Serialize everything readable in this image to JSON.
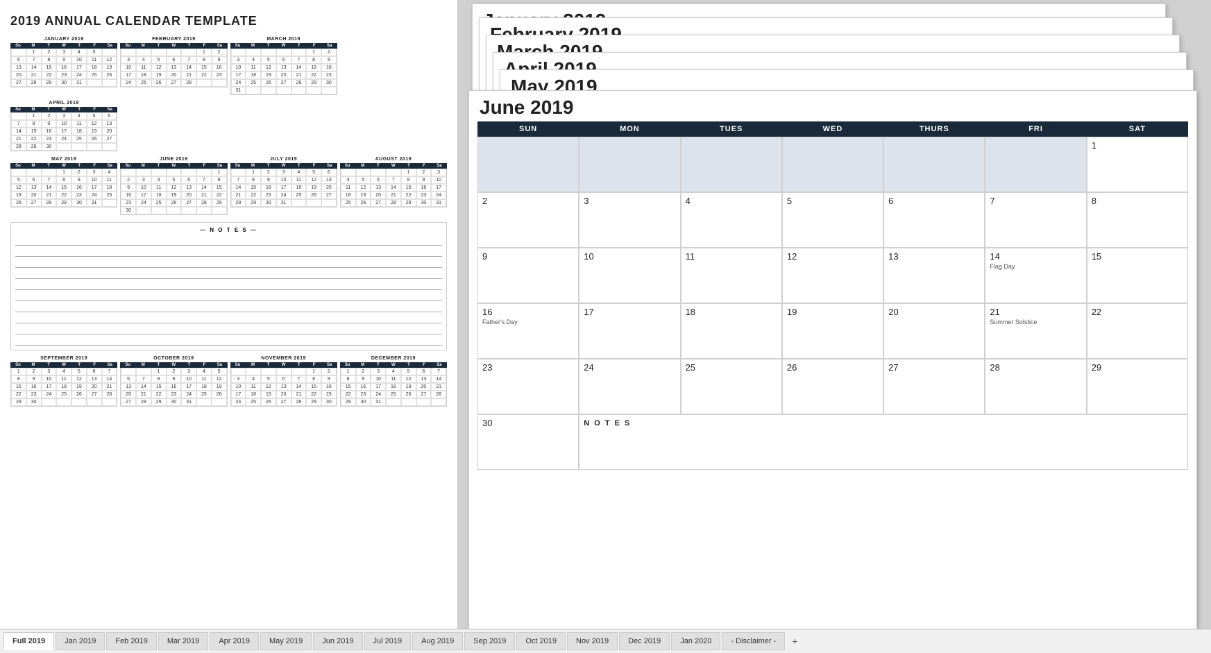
{
  "title": "2019 ANNUAL CALENDAR TEMPLATE",
  "months": {
    "jan": {
      "name": "JANUARY 2019",
      "header": [
        "Su",
        "M",
        "T",
        "W",
        "T",
        "F",
        "Sa"
      ],
      "weeks": [
        [
          "",
          "1",
          "2",
          "3",
          "4",
          "5",
          ""
        ],
        [
          "6",
          "7",
          "8",
          "9",
          "10",
          "11",
          "12"
        ],
        [
          "13",
          "14",
          "15",
          "16",
          "17",
          "18",
          "19"
        ],
        [
          "20",
          "21",
          "22",
          "23",
          "24",
          "25",
          "26"
        ],
        [
          "27",
          "28",
          "29",
          "30",
          "31",
          "",
          ""
        ]
      ]
    },
    "feb": {
      "name": "FEBRUARY 2019",
      "header": [
        "Su",
        "M",
        "T",
        "W",
        "T",
        "F",
        "Sa"
      ],
      "weeks": [
        [
          "",
          "",
          "",
          "",
          "",
          "1",
          "2"
        ],
        [
          "3",
          "4",
          "5",
          "6",
          "7",
          "8",
          "9"
        ],
        [
          "10",
          "11",
          "12",
          "13",
          "14",
          "15",
          "16"
        ],
        [
          "17",
          "18",
          "19",
          "20",
          "21",
          "22",
          "23"
        ],
        [
          "24",
          "25",
          "26",
          "27",
          "28",
          "",
          ""
        ]
      ]
    },
    "mar": {
      "name": "MARCH 2019",
      "header": [
        "Su",
        "M",
        "T",
        "W",
        "T",
        "F",
        "Sa"
      ],
      "weeks": [
        [
          "",
          "",
          "",
          "",
          "",
          "1",
          "2"
        ],
        [
          "3",
          "4",
          "5",
          "6",
          "7",
          "8",
          "9"
        ],
        [
          "10",
          "11",
          "12",
          "13",
          "14",
          "15",
          "16"
        ],
        [
          "17",
          "18",
          "19",
          "20",
          "21",
          "22",
          "23"
        ],
        [
          "24",
          "25",
          "26",
          "27",
          "28",
          "29",
          "30"
        ],
        [
          "31",
          "",
          "",
          "",
          "",
          "",
          ""
        ]
      ]
    },
    "apr": {
      "name": "APRIL 2019",
      "header": [
        "Su",
        "M",
        "T",
        "W",
        "T",
        "F",
        "Sa"
      ],
      "weeks": [
        [
          "",
          "1",
          "2",
          "3",
          "4",
          "5",
          "6"
        ],
        [
          "7",
          "8",
          "9",
          "10",
          "11",
          "12",
          "13"
        ],
        [
          "14",
          "15",
          "16",
          "17",
          "18",
          "19",
          "20"
        ],
        [
          "21",
          "22",
          "23",
          "24",
          "25",
          "26",
          "27"
        ],
        [
          "28",
          "29",
          "30",
          "",
          "",
          "",
          ""
        ]
      ]
    },
    "may": {
      "name": "MAY 2019",
      "header": [
        "Su",
        "M",
        "T",
        "W",
        "T",
        "F",
        "Sa"
      ],
      "weeks": [
        [
          "",
          "",
          "",
          "1",
          "2",
          "3",
          "4"
        ],
        [
          "5",
          "6",
          "7",
          "8",
          "9",
          "10",
          "11"
        ],
        [
          "12",
          "13",
          "14",
          "15",
          "16",
          "17",
          "18"
        ],
        [
          "19",
          "20",
          "21",
          "22",
          "23",
          "24",
          "25"
        ],
        [
          "26",
          "27",
          "28",
          "29",
          "30",
          "31",
          ""
        ]
      ]
    },
    "jun": {
      "name": "JUNE 2019",
      "title_display": "June 2019",
      "header": [
        "SUN",
        "MON",
        "TUES",
        "WED",
        "THURS",
        "FRI",
        "SAT"
      ],
      "weeks": [
        [
          "",
          "",
          "",
          "",
          "",
          "",
          "1"
        ],
        [
          "2",
          "3",
          "4",
          "5",
          "6",
          "7",
          "8"
        ],
        [
          "9",
          "10",
          "11",
          "12",
          "13",
          "14",
          "15"
        ],
        [
          "16",
          "17",
          "18",
          "19",
          "20",
          "21",
          "22"
        ],
        [
          "23",
          "24",
          "25",
          "26",
          "27",
          "28",
          "29"
        ],
        [
          "30",
          "",
          "",
          "",
          "",
          "",
          ""
        ]
      ],
      "holidays": {
        "14": "Flag Day",
        "16": "Father's Day",
        "21": "Summer Solstice"
      }
    },
    "jul": {
      "name": "JULY 2019",
      "header": [
        "Su",
        "M",
        "T",
        "W",
        "T",
        "F",
        "Sa"
      ],
      "weeks": [
        [
          "",
          "1",
          "2",
          "3",
          "4",
          "5",
          "6"
        ],
        [
          "7",
          "8",
          "9",
          "10",
          "11",
          "12",
          "13"
        ],
        [
          "14",
          "15",
          "16",
          "17",
          "18",
          "19",
          "20"
        ],
        [
          "21",
          "22",
          "23",
          "24",
          "25",
          "26",
          "27"
        ],
        [
          "28",
          "29",
          "30",
          "31",
          "",
          "",
          ""
        ]
      ]
    },
    "aug": {
      "name": "AUGUST 2019",
      "header": [
        "Su",
        "M",
        "T",
        "W",
        "T",
        "F",
        "Sa"
      ],
      "weeks": [
        [
          "",
          "",
          "",
          "",
          "1",
          "2",
          "3"
        ],
        [
          "4",
          "5",
          "6",
          "7",
          "8",
          "9",
          "10"
        ],
        [
          "11",
          "12",
          "13",
          "14",
          "15",
          "16",
          "17"
        ],
        [
          "18",
          "19",
          "20",
          "21",
          "22",
          "23",
          "24"
        ],
        [
          "25",
          "26",
          "27",
          "28",
          "29",
          "30",
          "31"
        ]
      ]
    },
    "sep": {
      "name": "SEPTEMBER 2019",
      "header": [
        "Su",
        "M",
        "T",
        "W",
        "T",
        "F",
        "Sa"
      ],
      "weeks": [
        [
          "1",
          "2",
          "3",
          "4",
          "5",
          "6",
          "7"
        ],
        [
          "8",
          "9",
          "10",
          "11",
          "12",
          "13",
          "14"
        ],
        [
          "15",
          "16",
          "17",
          "18",
          "19",
          "20",
          "21"
        ],
        [
          "22",
          "23",
          "24",
          "25",
          "26",
          "27",
          "28"
        ],
        [
          "29",
          "30",
          "",
          "",
          "",
          "",
          ""
        ]
      ]
    },
    "oct": {
      "name": "OCTOBER 2019",
      "header": [
        "Su",
        "M",
        "T",
        "W",
        "T",
        "F",
        "Sa"
      ],
      "weeks": [
        [
          "",
          "",
          "1",
          "2",
          "3",
          "4",
          "5"
        ],
        [
          "6",
          "7",
          "8",
          "9",
          "10",
          "11",
          "12"
        ],
        [
          "13",
          "14",
          "15",
          "16",
          "17",
          "18",
          "19"
        ],
        [
          "20",
          "21",
          "22",
          "23",
          "24",
          "25",
          "26"
        ],
        [
          "27",
          "28",
          "29",
          "30",
          "31",
          "",
          ""
        ]
      ]
    },
    "nov": {
      "name": "NOVEMBER 2019",
      "header": [
        "Su",
        "M",
        "T",
        "W",
        "T",
        "F",
        "Sa"
      ],
      "weeks": [
        [
          "",
          "",
          "",
          "",
          "",
          "1",
          "2"
        ],
        [
          "3",
          "4",
          "5",
          "6",
          "7",
          "8",
          "9"
        ],
        [
          "10",
          "11",
          "12",
          "13",
          "14",
          "15",
          "16"
        ],
        [
          "17",
          "18",
          "19",
          "20",
          "21",
          "22",
          "23"
        ],
        [
          "24",
          "25",
          "26",
          "27",
          "28",
          "29",
          "30"
        ]
      ]
    },
    "dec": {
      "name": "DECEMBER 2019",
      "header": [
        "Su",
        "M",
        "T",
        "W",
        "T",
        "F",
        "Sa"
      ],
      "weeks": [
        [
          "1",
          "2",
          "3",
          "4",
          "5",
          "6",
          "7"
        ],
        [
          "8",
          "9",
          "10",
          "11",
          "12",
          "13",
          "14"
        ],
        [
          "15",
          "16",
          "17",
          "18",
          "19",
          "20",
          "21"
        ],
        [
          "22",
          "23",
          "24",
          "25",
          "26",
          "27",
          "28"
        ],
        [
          "29",
          "30",
          "31",
          "",
          "",
          "",
          ""
        ]
      ]
    }
  },
  "tabs": [
    {
      "label": "Full 2019",
      "active": true
    },
    {
      "label": "Jan 2019",
      "active": false
    },
    {
      "label": "Feb 2019",
      "active": false
    },
    {
      "label": "Mar 2019",
      "active": false
    },
    {
      "label": "Apr 2019",
      "active": false
    },
    {
      "label": "May 2019",
      "active": false
    },
    {
      "label": "Jun 2019",
      "active": false
    },
    {
      "label": "Jul 2019",
      "active": false
    },
    {
      "label": "Aug 2019",
      "active": false
    },
    {
      "label": "Sep 2019",
      "active": false
    },
    {
      "label": "Oct 2019",
      "active": false
    },
    {
      "label": "Nov 2019",
      "active": false
    },
    {
      "label": "Dec 2019",
      "active": false
    },
    {
      "label": "Jan 2020",
      "active": false
    },
    {
      "label": "- Disclaimer -",
      "active": false
    }
  ],
  "notes_label": "— N O T E S —",
  "notes_label_inline": "N O T E S"
}
